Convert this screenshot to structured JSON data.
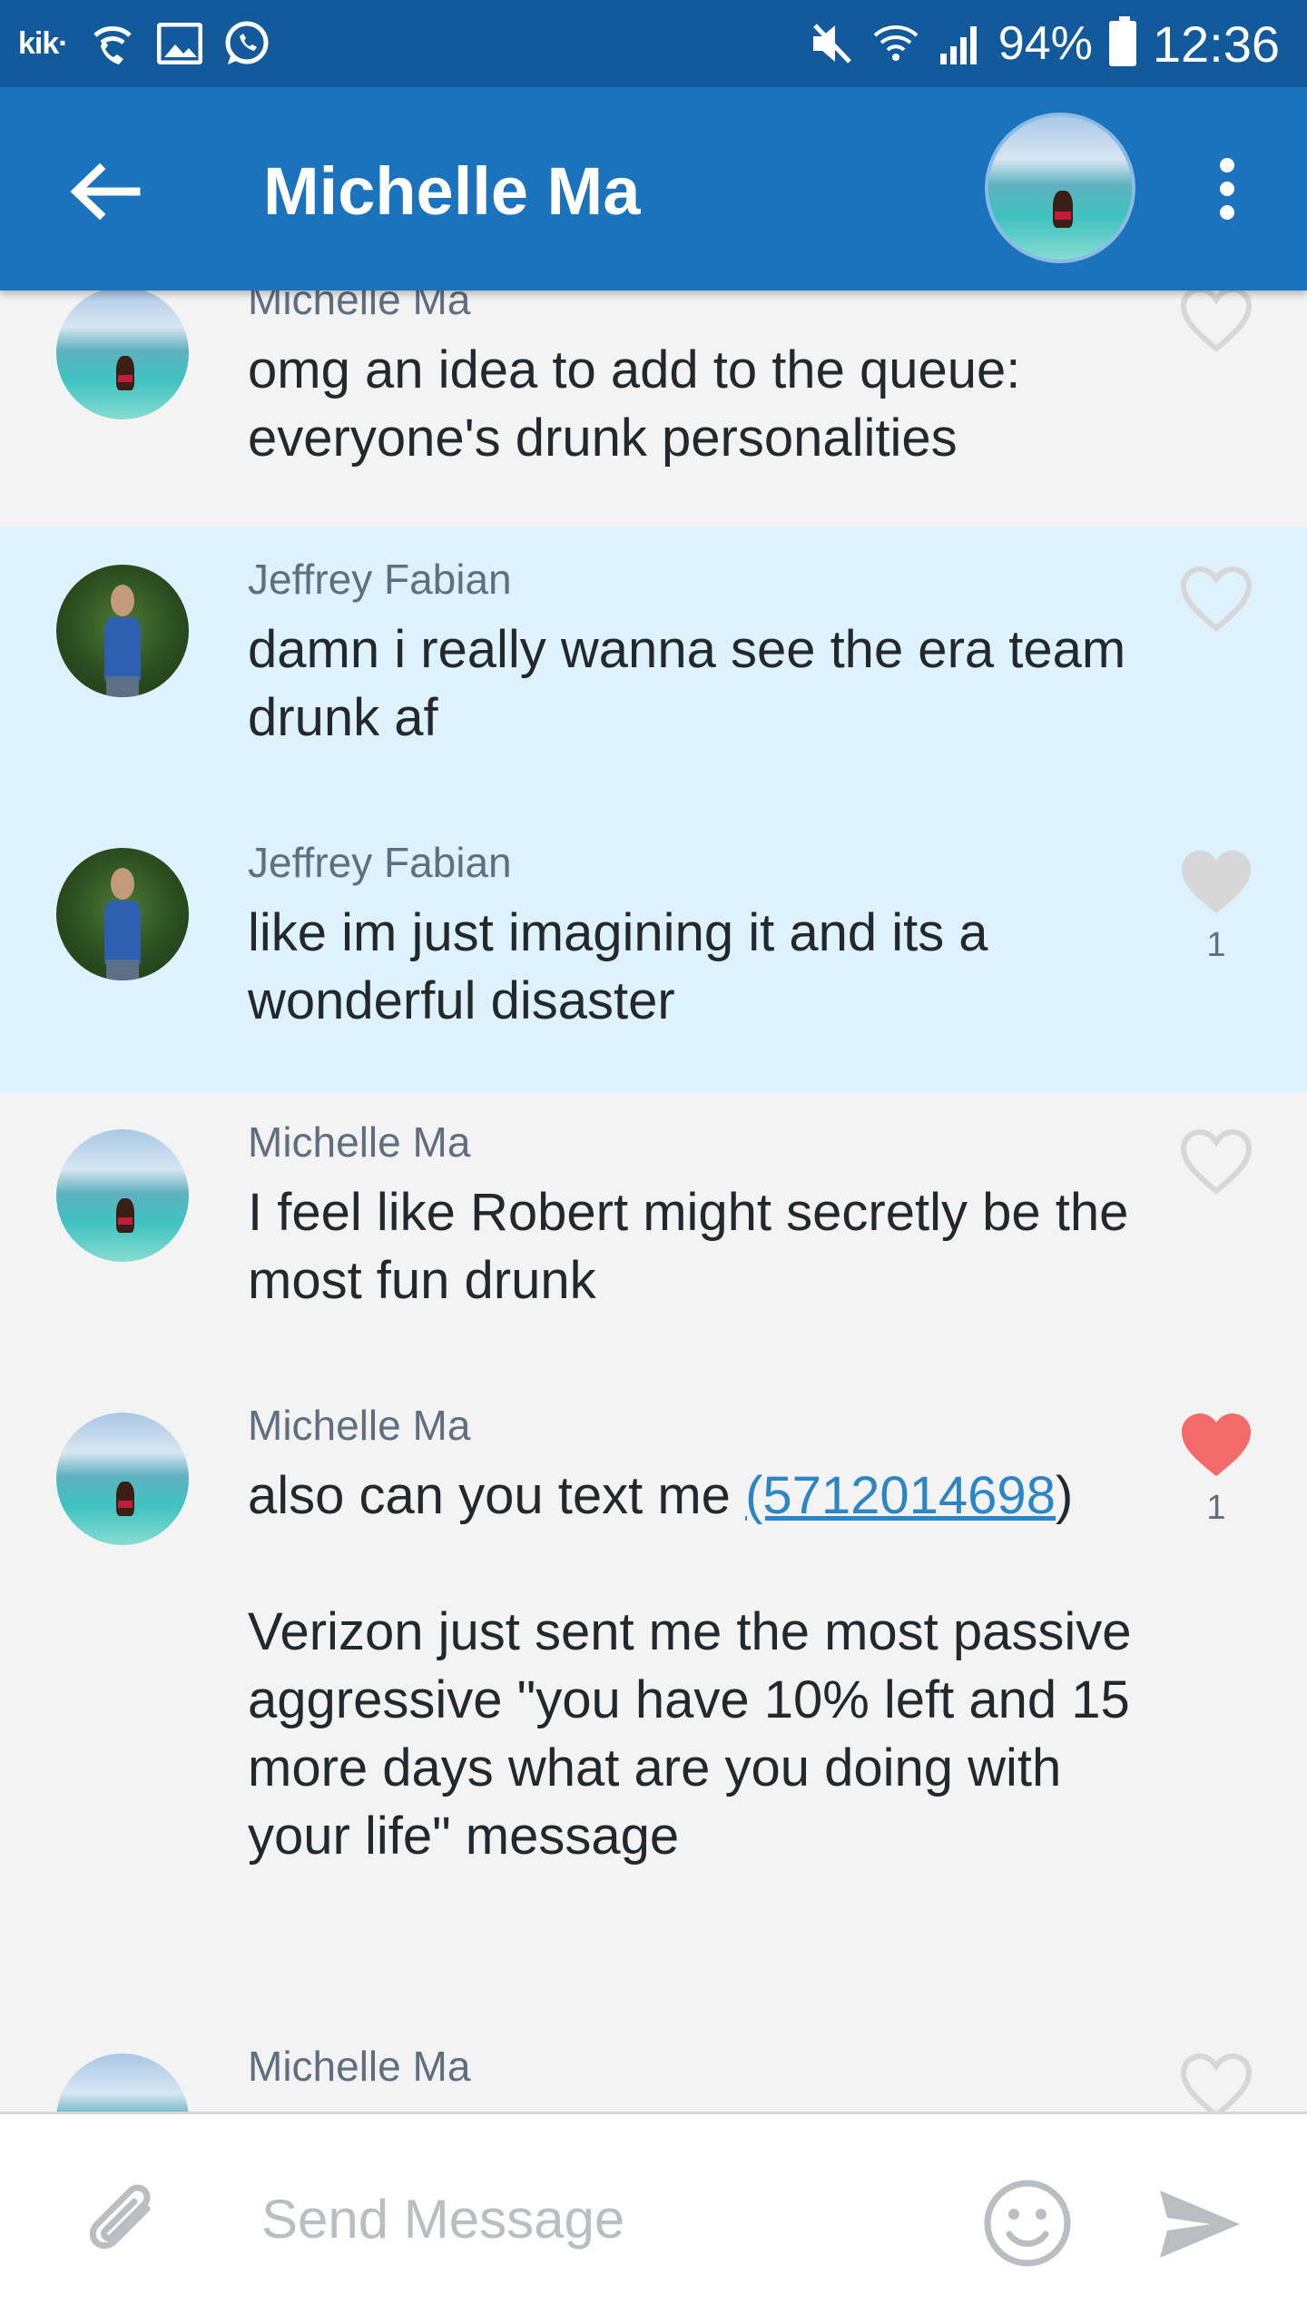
{
  "status_bar": {
    "kik_label": "kik·",
    "battery": "94%",
    "time": "12:36",
    "icons": [
      "kik-icon",
      "wifi-call-icon",
      "gallery-icon",
      "whatsapp-icon",
      "mute-icon",
      "wifi-icon",
      "signal-icon",
      "battery-icon"
    ]
  },
  "header": {
    "title": "Michelle Ma",
    "back_icon": "arrow-left-icon",
    "menu_icon": "more-vert-icon"
  },
  "messages": [
    {
      "sender": "Michelle Ma",
      "text": "omg an idea to add to the queue: everyone's drunk personalities",
      "liked": false,
      "like_count": "",
      "avatar": "ocean",
      "highlighted": false
    },
    {
      "sender": "Jeffrey Fabian",
      "text": "damn i really wanna see the era team drunk af",
      "liked": false,
      "like_count": "",
      "avatar": "park",
      "highlighted": true
    },
    {
      "sender": "Jeffrey Fabian",
      "text": "like im just imagining it and its a wonderful disaster",
      "liked": "grey",
      "like_count": "1",
      "avatar": "park",
      "highlighted": true
    },
    {
      "sender": "Michelle Ma",
      "text": "I feel like Robert might secretly be the most fun drunk",
      "liked": false,
      "like_count": "",
      "avatar": "ocean",
      "highlighted": false
    },
    {
      "sender": "Michelle Ma",
      "text_before_link": "also can you text me ",
      "link": "(5712014698",
      "text_after_link": ")\n\nVerizon just sent me the most passive aggressive \"you have 10% left and 15 more days what are you doing with your life\" message",
      "liked": "red",
      "like_count": "1",
      "avatar": "ocean",
      "highlighted": false
    },
    {
      "sender": "Michelle Ma",
      "text": "",
      "liked": false,
      "like_count": "",
      "avatar": "ocean",
      "highlighted": false
    }
  ],
  "composer": {
    "placeholder": "Send Message",
    "attach_icon": "paperclip-icon",
    "emoji_icon": "smiley-icon",
    "send_icon": "send-icon"
  },
  "colors": {
    "status_bar": "#125a9c",
    "app_bar": "#1c73bd",
    "highlight_row": "#ddf2fc",
    "liked_red": "#f46a6a",
    "liked_grey": "#d7d7d7",
    "link": "#2c86c5"
  }
}
